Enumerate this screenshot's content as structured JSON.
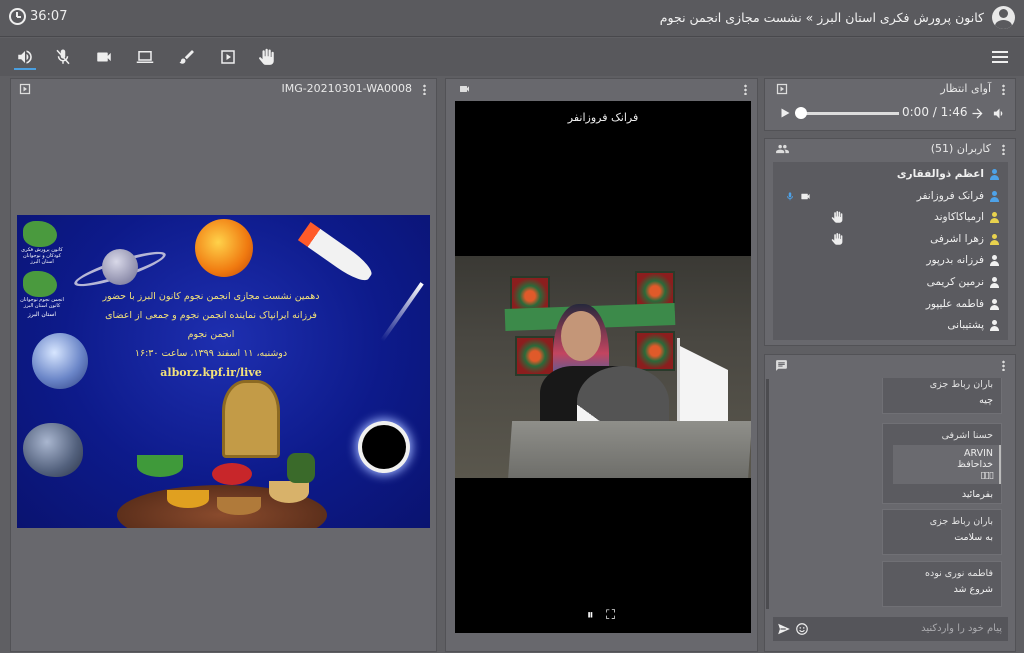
{
  "header": {
    "timer": "36:07",
    "title": "کانون پرورش فکری استان البرز » نشست مجازی انجمن نجوم"
  },
  "toolbar": {
    "buttons": [
      "speaker-icon",
      "mic-muted-icon",
      "camera-icon",
      "screen-share-icon",
      "brush-icon",
      "media-icon",
      "hand-icon"
    ],
    "menu": "menu-icon"
  },
  "presentation": {
    "filename": "IMG-20210301-WA0008",
    "slide": {
      "line1": "دهمین نشست مجازی انجمن نجوم کانون البرز با حضور",
      "line2": "فرزانه ایرانپاک نماینده انجمن نجوم و جمعی از اعضای",
      "line3": "انجمن نجوم",
      "line4": "دوشنبه، ۱۱ اسفند ۱۳۹۹، ساعت ۱۶:۳۰",
      "url": "alborz.kpf.ir/live",
      "logo_top": "کانون پرورش فکری کودکان و نوجوانان استان البرز",
      "logo_bottom": "انجمن نجوم نوجوانان کانون استان البرز",
      "logo_city": "استان البرز"
    }
  },
  "video": {
    "name": "فرانک فروزانفر",
    "pause": "⏸",
    "fullscreen": "⛶"
  },
  "audio": {
    "title": "آوای انتظار",
    "time": "0:00 / 1:46",
    "progress": 0
  },
  "users": {
    "title": "کاربران (51)",
    "items": [
      {
        "name": "اعظم ذوالفقاری",
        "color": "#4ea2e8",
        "bold": true
      },
      {
        "name": "فرانک فروزانفر",
        "color": "#4ea2e8",
        "bold": false
      },
      {
        "name": "ارمیاکاکاوند",
        "color": "#e8d24e",
        "bold": false
      },
      {
        "name": "زهرا اشرفی",
        "color": "#e8d24e",
        "bold": false
      },
      {
        "name": "فرزانه بدرپور",
        "color": "#f0f0f0",
        "bold": false
      },
      {
        "name": "نرمین کریمی",
        "color": "#f0f0f0",
        "bold": false
      },
      {
        "name": "فاطمه علیپور",
        "color": "#f0f0f0",
        "bold": false
      },
      {
        "name": "پشتیبانی",
        "color": "#f0f0f0",
        "bold": false
      }
    ]
  },
  "chat": {
    "messages": [
      {
        "sender": "باران رباط جزی",
        "text": "چیه"
      },
      {
        "sender": "حسنا اشرفی",
        "quote1": "ARVIN",
        "quote2": "خداحافظ",
        "text": "بفرمائید"
      },
      {
        "sender": "باران رباط جزی",
        "text": "به سلامت"
      },
      {
        "sender": "فاطمه نوری نوده",
        "text": "شروع شد"
      }
    ],
    "placeholder": "پیام خود را واردکنید"
  }
}
